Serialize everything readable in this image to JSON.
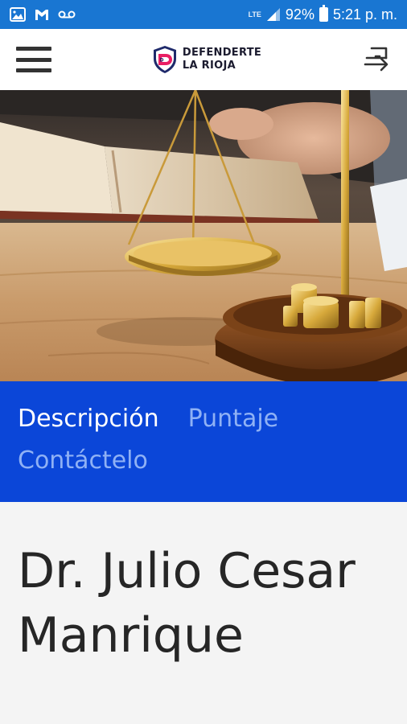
{
  "status_bar": {
    "network": "LTE",
    "battery": "92%",
    "time": "5:21 p. m."
  },
  "header": {
    "logo_line1": "DEFENDERTE",
    "logo_line2": "LA RIOJA",
    "logo_monogram": "D"
  },
  "tabs": [
    {
      "label": "Descripción",
      "active": true
    },
    {
      "label": "Puntaje",
      "active": false
    },
    {
      "label": "Contáctelo",
      "active": false
    }
  ],
  "profile": {
    "title": "Dr. Julio Cesar Manrique"
  },
  "colors": {
    "status_bar": "#1976d2",
    "tabs_bg": "#0b46d8",
    "tab_active": "#ffffff",
    "tab_inactive": "#8fb1f5",
    "logo_pink": "#e91e63",
    "logo_navy": "#1f2a6b"
  }
}
